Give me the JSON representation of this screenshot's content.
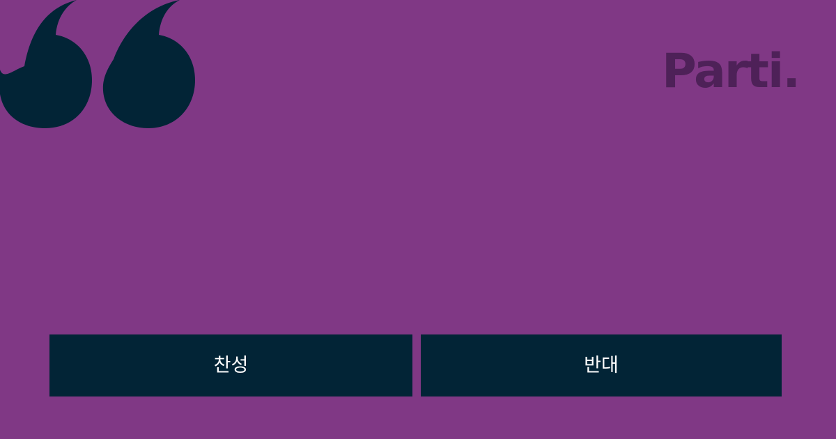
{
  "logo": {
    "text": "Parti.",
    "color": "#4e2158"
  },
  "icons": {
    "quote": "open-quote-icon"
  },
  "colors": {
    "background": "#803885",
    "button_bg": "#022436",
    "button_text": "#ffffff",
    "quote": "#022436"
  },
  "vote": {
    "agree_label": "찬성",
    "disagree_label": "반대"
  }
}
